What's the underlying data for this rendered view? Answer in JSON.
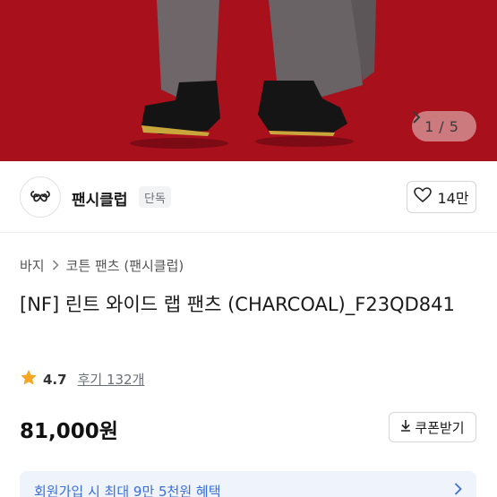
{
  "hero": {
    "background": "#a8101c",
    "pager": {
      "current": "1",
      "separator": "/",
      "total": "5",
      "next_icon": "chevron-right-icon"
    }
  },
  "brand": {
    "logo_icon": "brand-logo",
    "name": "팬시클럽",
    "badge": "단독",
    "likes": "14만"
  },
  "breadcrumb": [
    "바지",
    "코튼 팬츠 (팬시클럽)"
  ],
  "product": {
    "title": "[NF] 린트 와이드 랩 팬츠 (CHARCOAL)_F23QD841",
    "rating": "4.7",
    "reviews": "후기 132개",
    "price": "81,000원"
  },
  "coupon": {
    "label": "쿠폰받기"
  },
  "promo": {
    "text": "회원가입 시 최대 9만 5천원 혜택",
    "accent": "#3b6fd8"
  }
}
